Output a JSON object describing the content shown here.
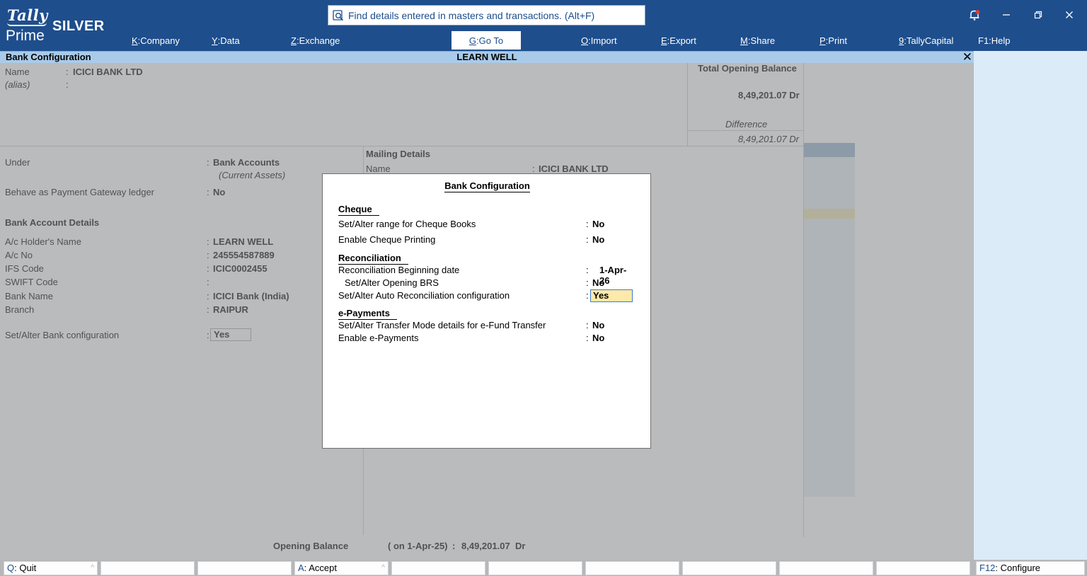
{
  "app": {
    "logo_line1": "Tally",
    "logo_line2": "Prime",
    "edition": "SILVER"
  },
  "search": {
    "placeholder": "Find details entered in masters and transactions. (Alt+F)"
  },
  "menu": [
    {
      "key": "K",
      "label": "Company"
    },
    {
      "key": "Y",
      "label": "Data"
    },
    {
      "key": "Z",
      "label": "Exchange"
    },
    {
      "key": "G",
      "label": "Go To"
    },
    {
      "key": "O",
      "label": "Import"
    },
    {
      "key": "E",
      "label": "Export"
    },
    {
      "key": "M",
      "label": "Share"
    },
    {
      "key": "P",
      "label": "Print"
    },
    {
      "key": "9",
      "label": "TallyCapital"
    },
    {
      "key": "F1",
      "label": "Help"
    }
  ],
  "window_controls": {
    "close": "✕"
  },
  "screen": {
    "title": "Bank Configuration",
    "company": "LEARN WELL"
  },
  "form": {
    "name_label": "Name",
    "name_value": "ICICI BANK LTD",
    "alias_label": "(alias)",
    "colon": ":",
    "total_opening_label": "Total Opening Balance",
    "total_opening_value": "8,49,201.07 Dr",
    "difference_label": "Difference",
    "difference_value": "8,49,201.07 Dr",
    "under_label": "Under",
    "under_value": "Bank Accounts",
    "under_sub": "(Current Assets)",
    "gateway_label": "Behave as Payment Gateway ledger",
    "gateway_value": "No",
    "mailing_heading": "Mailing Details",
    "mailing_name_label": "Name",
    "mailing_name_value": "ICICI BANK LTD",
    "bank_details_heading": "Bank Account Details",
    "holder_label": "A/c Holder's Name",
    "holder_value": "LEARN WELL",
    "acno_label": "A/c No",
    "acno_value": "245554587889",
    "ifs_label": "IFS Code",
    "ifs_value": "ICIC0002455",
    "swift_label": "SWIFT Code",
    "bankname_label": "Bank Name",
    "bankname_value": "ICICI Bank (India)",
    "branch_label": "Branch",
    "branch_value": "RAIPUR",
    "config_label": "Set/Alter Bank configuration",
    "config_value": "Yes",
    "opening_label": "Opening Balance",
    "opening_date": "( on 1-Apr-25)",
    "opening_value": "8,49,201.07",
    "opening_side": "Dr"
  },
  "popup": {
    "title": "Bank Configuration",
    "colon": ":",
    "cheque_heading": "Cheque",
    "cheque_range_label": "Set/Alter range for Cheque Books",
    "cheque_range_value": "No",
    "cheque_print_label": "Enable Cheque Printing",
    "cheque_print_value": "No",
    "recon_heading": "Reconciliation",
    "recon_date_label": "Reconciliation Beginning date",
    "recon_date_value": "1-Apr-26",
    "opening_brs_label": "Set/Alter Opening BRS",
    "opening_brs_value": "No",
    "auto_recon_label": "Set/Alter Auto Reconciliation configuration",
    "auto_recon_value": "Yes",
    "epay_heading": "e-Payments",
    "transfer_mode_label": "Set/Alter Transfer Mode details for e-Fund Transfer",
    "transfer_mode_value": "No",
    "enable_epay_label": "Enable e-Payments",
    "enable_epay_value": "No"
  },
  "bottom": {
    "quit_key": "Q",
    "quit_label": "Quit",
    "accept_key": "A",
    "accept_label": "Accept",
    "configure_key": "F12",
    "configure_label": "Configure",
    "caret": "^"
  },
  "colors": {
    "header_bg": "#1e4e8c",
    "titlebar_bg": "#a9cbe9",
    "highlight_bg": "#fde9a9"
  }
}
